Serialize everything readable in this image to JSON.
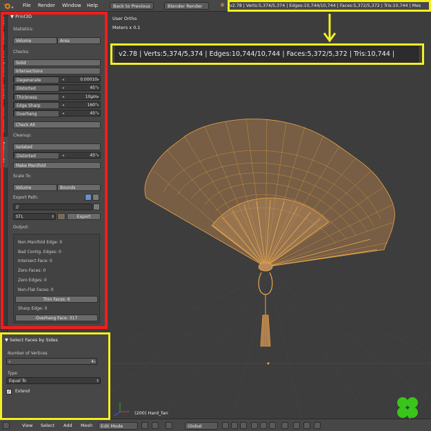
{
  "menu": {
    "items": [
      "File",
      "Render",
      "Window",
      "Help"
    ],
    "back_button": "Back to Previous",
    "engine": "Blender Render",
    "stats": "v2.78 | Verts:5,374/5,374 | Edges:10,744/10,744 | Faces:5,372/5,372 | Tris:10,744 | Mes"
  },
  "tabs": [
    "Tools",
    "Create",
    "Shading / UVs",
    "Options",
    "Grease Pencil",
    "3D Printing"
  ],
  "print3d": {
    "title": "Print3D",
    "statistics": "Statistics:",
    "volume": "Volume",
    "area": "Area",
    "checks": "Checks:",
    "solid": "Solid",
    "intersections": "Intersections",
    "degenerate": {
      "label": "Degenerate",
      "value": "0.00010"
    },
    "distorted": {
      "label": "Distorted",
      "value": "45°"
    },
    "thickness": {
      "label": "Thickness",
      "value": "10µm"
    },
    "edge_sharp": {
      "label": "Edge Sharp",
      "value": "160°"
    },
    "overhang": {
      "label": "Overhang",
      "value": "45°"
    },
    "check_all": "Check All",
    "cleanup": "Cleanup:",
    "isolated": "Isolated",
    "cleanup_distorted": {
      "label": "Distorted",
      "value": "45°"
    },
    "make_manifold": "Make Manifold",
    "scale_to": "Scale To:",
    "bounds": "Bounds",
    "export_path": "Export Path:",
    "path_value": "//",
    "format": "STL",
    "export": "Export",
    "output": "Output:",
    "results": {
      "non_manifold": "Non Manifold Edge: 0",
      "bad_contig": "Bad Contig. Edges: 0",
      "intersect": "Intersect Face: 0",
      "zero_faces": "Zero Faces: 0",
      "zero_edges": "Zero Edges: 0",
      "non_flat": "Non-Flat Faces: 0",
      "thin_faces": "Thin Faces: 6",
      "sharp_edge": "Sharp Edge: 0",
      "overhang_face": "Overhang Face: 317"
    }
  },
  "operator": {
    "title": "Select Faces by Sides",
    "number_label": "Number of Vertices",
    "number_value": "4",
    "type_label": "Type",
    "type_value": "Equal To",
    "extend": "Extend"
  },
  "viewport": {
    "view_name": "User Ortho",
    "units": "Meters x 0.1",
    "object": "(200) Hard_fan",
    "callout_stats": "v2.78 | Verts:5,374/5,374 | Edges:10,744/10,744 | Faces:5,372/5,372 | Tris:10,744 |"
  },
  "bottom": {
    "items": [
      "View",
      "Select",
      "Add",
      "Mesh"
    ],
    "mode": "Edit Mode",
    "pivot": "Global"
  },
  "colors": {
    "highlight_red": "#ff1a1a",
    "highlight_yellow": "#f4f020",
    "mesh_orange": "#e8a04c",
    "clover_green": "#39c51a"
  }
}
